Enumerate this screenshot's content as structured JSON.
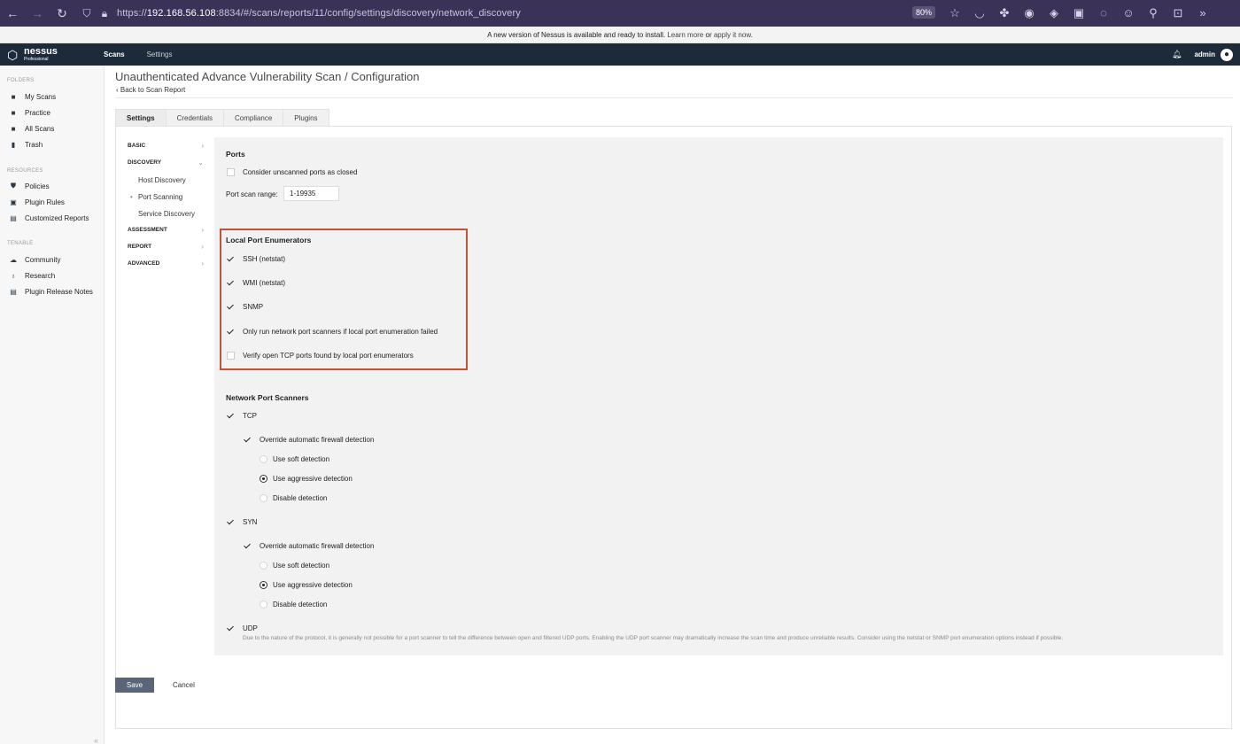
{
  "browser": {
    "url_prefix": "https://",
    "url_host": "192.168.56.108",
    "url_rest": ":8834/#/scans/reports/11/config/settings/discovery/network_discovery",
    "zoom": "80%"
  },
  "banner": {
    "text": "A new version of Nessus is available and ready to install.",
    "learn_more": "Learn more",
    "or": "or",
    "apply": "apply it now."
  },
  "header": {
    "brand": "nessus",
    "edition": "Professional",
    "nav": [
      "Scans",
      "Settings"
    ],
    "user": "admin"
  },
  "sidebar": {
    "folders_label": "FOLDERS",
    "folders": [
      "My Scans",
      "Practice",
      "All Scans",
      "Trash"
    ],
    "resources_label": "RESOURCES",
    "resources": [
      "Policies",
      "Plugin Rules",
      "Customized Reports"
    ],
    "tenable_label": "TENABLE",
    "tenable": [
      "Community",
      "Research",
      "Plugin Release Notes"
    ]
  },
  "page": {
    "title": "Unauthenticated Advance Vulnerability Scan / Configuration",
    "back": "Back to Scan Report"
  },
  "tabs": [
    "Settings",
    "Credentials",
    "Compliance",
    "Plugins"
  ],
  "menu": {
    "basic": "BASIC",
    "discovery": "DISCOVERY",
    "host_discovery": "Host Discovery",
    "port_scanning": "Port Scanning",
    "service_discovery": "Service Discovery",
    "assessment": "ASSESSMENT",
    "report": "REPORT",
    "advanced": "ADVANCED"
  },
  "ports": {
    "title": "Ports",
    "unscanned_closed": "Consider unscanned ports as closed",
    "range_label": "Port scan range:",
    "range_value": "1-19935"
  },
  "local": {
    "title": "Local Port Enumerators",
    "ssh": "SSH (netstat)",
    "wmi": "WMI (netstat)",
    "snmp": "SNMP",
    "only_run": "Only run network port scanners if local port enumeration failed",
    "verify": "Verify open TCP ports found by local port enumerators"
  },
  "network": {
    "title": "Network Port Scanners",
    "tcp": "TCP",
    "syn": "SYN",
    "udp": "UDP",
    "override": "Override automatic firewall detection",
    "soft": "Use soft detection",
    "aggressive": "Use aggressive detection",
    "disable": "Disable detection",
    "udp_note": "Due to the nature of the protocol, it is generally not possible for a port scanner to tell the difference between open and filtered UDP ports. Enabling the UDP port scanner may dramatically increase the scan time and produce unreliable results. Consider using the netstat or SNMP port enumeration options instead if possible."
  },
  "actions": {
    "save": "Save",
    "cancel": "Cancel"
  }
}
